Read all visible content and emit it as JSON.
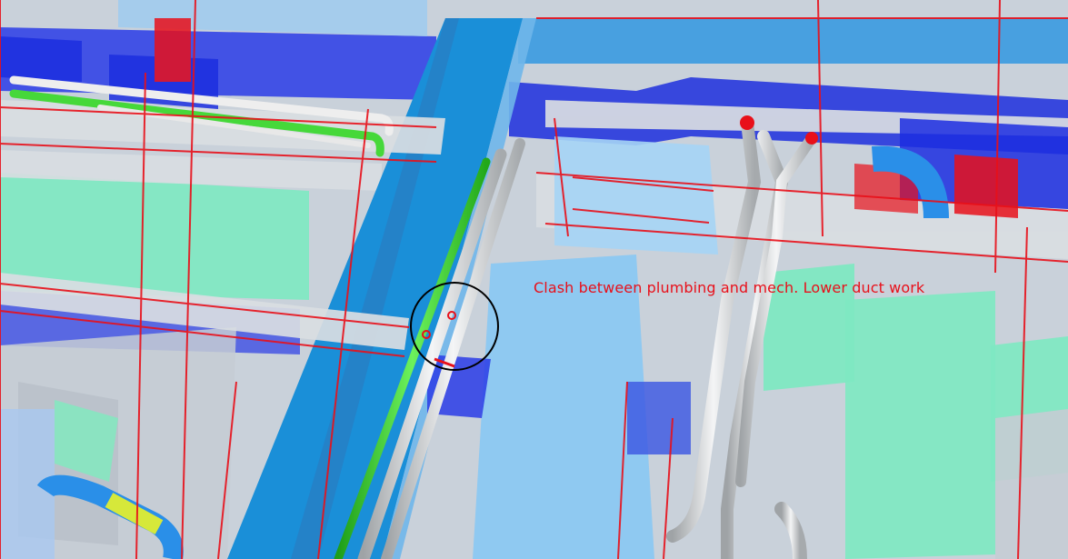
{
  "viewer": {
    "annotation_text": "Clash between plumbing and mech. Lower duct work"
  },
  "colors": {
    "duct_supply": "#1a8fd8",
    "duct_return": "#1c2ee0",
    "duct_light": "#8cc8f2",
    "mech_unit": "#7fe8c2",
    "pipe_gray": "#d2d4d6",
    "pipe_green": "#38d22a",
    "clash_red": "#e8101a",
    "concrete": "#d9dde2"
  },
  "icons": {
    "clash_marker": "circle-marker-icon"
  }
}
